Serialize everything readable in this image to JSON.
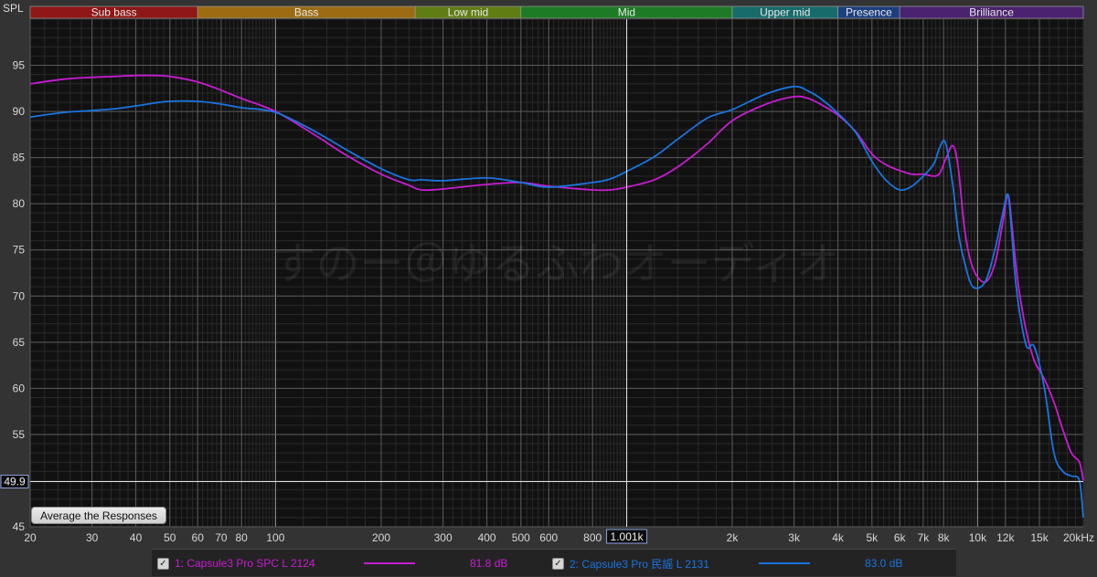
{
  "bands": [
    {
      "label": "Sub bass",
      "f0": 20,
      "f1": 60,
      "color": "#8e1717"
    },
    {
      "label": "Bass",
      "f0": 60,
      "f1": 250,
      "color": "#9b6c12"
    },
    {
      "label": "Low mid",
      "f0": 250,
      "f1": 500,
      "color": "#5f7d13"
    },
    {
      "label": "Mid",
      "f0": 500,
      "f1": 2000,
      "color": "#1d7a25"
    },
    {
      "label": "Upper mid",
      "f0": 2000,
      "f1": 4000,
      "color": "#176b6b"
    },
    {
      "label": "Presence",
      "f0": 4000,
      "f1": 6000,
      "color": "#1c3f7e"
    },
    {
      "label": "Brilliance",
      "f0": 6000,
      "f1": 20000,
      "color": "#4a226e"
    }
  ],
  "ylabel": "SPL",
  "xunit_label": "20kHz",
  "cursor": {
    "x_label": "1.001k",
    "x": 1001,
    "y_label": "49.9",
    "y": 49.9
  },
  "watermark": "すのー＠ゆるふわオーディオ",
  "average_button": "Average the Responses",
  "colors": {
    "background": "#111111",
    "grid_major": "#5a5a5a",
    "grid_minor": "#2a2a2a",
    "axis_text": "#d8d8d8"
  },
  "legend": [
    {
      "check": "✓",
      "name": "1: Capsule3 Pro SPC L 2124",
      "value": "81.8 dB",
      "color": "#c81cd2"
    },
    {
      "check": "✓",
      "name": "2: Capsule3 Pro 民謡 L 2131",
      "value": "83.0 dB",
      "color": "#1a74e0"
    }
  ],
  "chart_data": {
    "type": "line",
    "title": "",
    "xlabel": "",
    "ylabel": "SPL",
    "xscale": "log",
    "xlim": [
      20,
      20000
    ],
    "ylim": [
      45,
      100
    ],
    "grid": true,
    "legend_position": "bottom",
    "x_ticks": [
      {
        "v": 20,
        "l": "20"
      },
      {
        "v": 30,
        "l": "30"
      },
      {
        "v": 40,
        "l": "40"
      },
      {
        "v": 50,
        "l": "50"
      },
      {
        "v": 60,
        "l": "60"
      },
      {
        "v": 70,
        "l": "70"
      },
      {
        "v": 80,
        "l": "80"
      },
      {
        "v": 100,
        "l": "100"
      },
      {
        "v": 200,
        "l": "200"
      },
      {
        "v": 300,
        "l": "300"
      },
      {
        "v": 400,
        "l": "400"
      },
      {
        "v": 500,
        "l": "500"
      },
      {
        "v": 600,
        "l": "600"
      },
      {
        "v": 800,
        "l": "800"
      },
      {
        "v": 2000,
        "l": "2k"
      },
      {
        "v": 3000,
        "l": "3k"
      },
      {
        "v": 4000,
        "l": "4k"
      },
      {
        "v": 5000,
        "l": "5k"
      },
      {
        "v": 6000,
        "l": "6k"
      },
      {
        "v": 7000,
        "l": "7k"
      },
      {
        "v": 8000,
        "l": "8k"
      },
      {
        "v": 10000,
        "l": "10k"
      },
      {
        "v": 12000,
        "l": "12k"
      },
      {
        "v": 15000,
        "l": "15k"
      }
    ],
    "y_ticks": [
      {
        "v": 95,
        "l": "95"
      },
      {
        "v": 90,
        "l": "90"
      },
      {
        "v": 85,
        "l": "85"
      },
      {
        "v": 80,
        "l": "80"
      },
      {
        "v": 75,
        "l": "75"
      },
      {
        "v": 70,
        "l": "70"
      },
      {
        "v": 65,
        "l": "65"
      },
      {
        "v": 60,
        "l": "60"
      },
      {
        "v": 55,
        "l": "55"
      },
      {
        "v": 45,
        "l": "45"
      }
    ],
    "series": [
      {
        "name": "1: Capsule3 Pro SPC L 2124",
        "color": "#c81cd2",
        "x": [
          20,
          25,
          30,
          35,
          40,
          45,
          50,
          60,
          70,
          80,
          100,
          130,
          160,
          200,
          240,
          260,
          300,
          400,
          500,
          600,
          800,
          900,
          1000,
          1200,
          1400,
          1700,
          2000,
          2500,
          3000,
          3300,
          3600,
          4000,
          4500,
          5000,
          5500,
          6000,
          6500,
          7000,
          7500,
          7800,
          8100,
          8500,
          8800,
          9200,
          9700,
          10500,
          11200,
          11800,
          12200,
          12500,
          12800,
          13200,
          13800,
          14500,
          15500,
          16500,
          17500,
          18500,
          19500,
          20000
        ],
        "y": [
          93,
          93.5,
          93.7,
          93.8,
          93.9,
          93.9,
          93.8,
          93.2,
          92.3,
          91.4,
          90.0,
          87.4,
          85.2,
          83.2,
          82.0,
          81.5,
          81.6,
          82.1,
          82.3,
          81.9,
          81.5,
          81.5,
          81.8,
          82.6,
          84.0,
          86.5,
          89.0,
          90.8,
          91.6,
          91.4,
          90.7,
          89.6,
          87.8,
          85.4,
          84.2,
          83.6,
          83.2,
          83.2,
          83.0,
          83.3,
          84.8,
          86.3,
          84.0,
          77.0,
          73.0,
          71.5,
          73.5,
          78.0,
          81.0,
          78.0,
          74.0,
          70.0,
          66.0,
          63.0,
          61.0,
          58.5,
          55.5,
          53.0,
          52.0,
          50.0
        ]
      },
      {
        "name": "2: Capsule3 Pro 民謡 L 2131",
        "color": "#1a74e0",
        "x": [
          20,
          25,
          30,
          35,
          40,
          45,
          50,
          60,
          70,
          80,
          100,
          130,
          160,
          200,
          240,
          260,
          300,
          400,
          500,
          600,
          800,
          900,
          1000,
          1200,
          1400,
          1700,
          2000,
          2500,
          3000,
          3300,
          3600,
          4000,
          4500,
          5000,
          5500,
          6000,
          6500,
          7000,
          7500,
          7800,
          8100,
          8500,
          8800,
          9200,
          9700,
          10500,
          11200,
          11800,
          12200,
          12500,
          12800,
          13200,
          13800,
          14500,
          15500,
          16500,
          17500,
          18500,
          19500,
          20000
        ],
        "y": [
          89.4,
          89.9,
          90.1,
          90.3,
          90.6,
          90.9,
          91.1,
          91.1,
          90.8,
          90.4,
          89.9,
          87.8,
          85.8,
          83.8,
          82.6,
          82.6,
          82.5,
          82.8,
          82.3,
          81.8,
          82.3,
          82.7,
          83.5,
          85.1,
          87.0,
          89.3,
          90.2,
          91.9,
          92.7,
          92.2,
          91.3,
          89.8,
          87.7,
          84.6,
          82.5,
          81.5,
          81.9,
          83.0,
          84.3,
          86.1,
          86.6,
          82.0,
          77.0,
          73.5,
          71.0,
          71.5,
          75.0,
          79.0,
          81.0,
          77.0,
          72.0,
          68.0,
          64.5,
          64.5,
          60.0,
          53.0,
          51.0,
          50.5,
          50.0,
          46.0
        ]
      }
    ]
  }
}
